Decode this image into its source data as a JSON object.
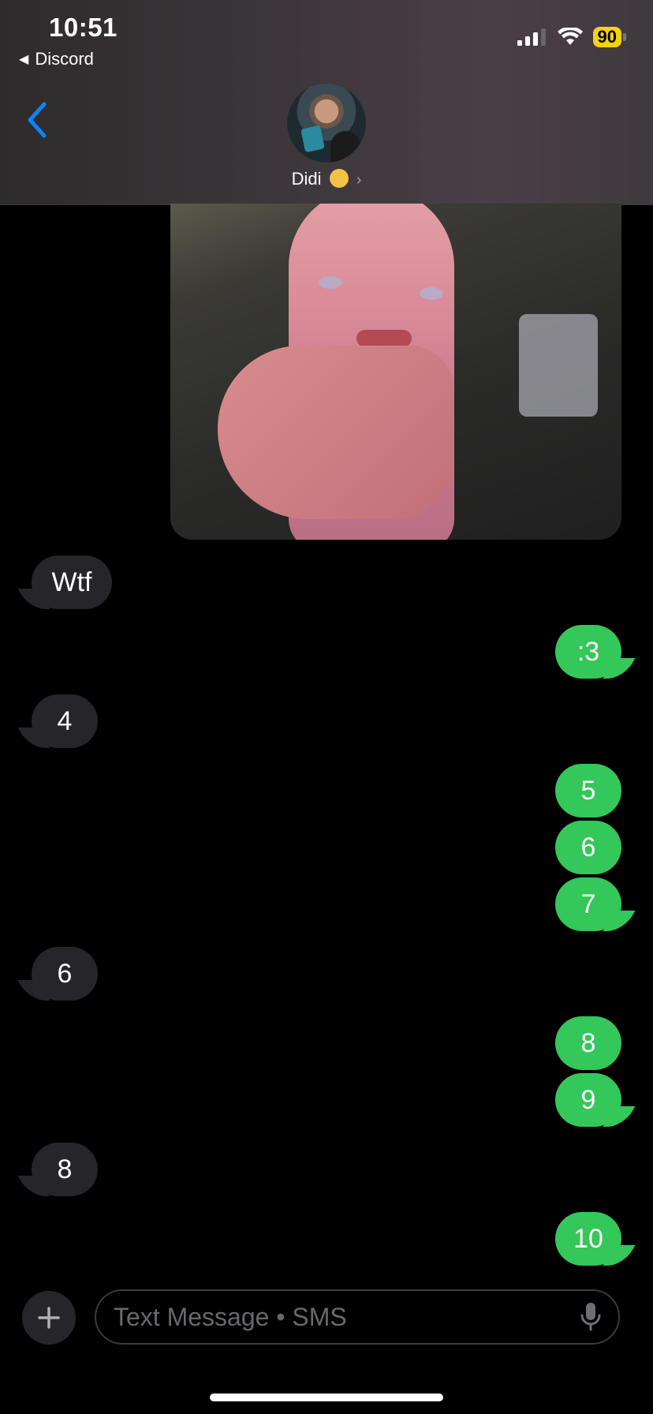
{
  "status_bar": {
    "time": "10:51",
    "back_app": "Discord",
    "battery": "90"
  },
  "header": {
    "contact_name": "Didi"
  },
  "messages": [
    {
      "side": "received",
      "text": "Wtf"
    },
    {
      "side": "sent",
      "text": ":3"
    },
    {
      "side": "received",
      "text": "4"
    },
    {
      "side": "sent",
      "text": "5"
    },
    {
      "side": "sent",
      "text": "6"
    },
    {
      "side": "sent",
      "text": "7"
    },
    {
      "side": "received",
      "text": "6"
    },
    {
      "side": "sent",
      "text": "8"
    },
    {
      "side": "sent",
      "text": "9"
    },
    {
      "side": "received",
      "text": "8"
    },
    {
      "side": "sent",
      "text": "10"
    }
  ],
  "composer": {
    "placeholder": "Text Message • SMS"
  },
  "colors": {
    "sent_bubble": "#34c759",
    "received_bubble": "#26252a",
    "accent": "#0a84ff",
    "battery": "#f5d30b"
  }
}
